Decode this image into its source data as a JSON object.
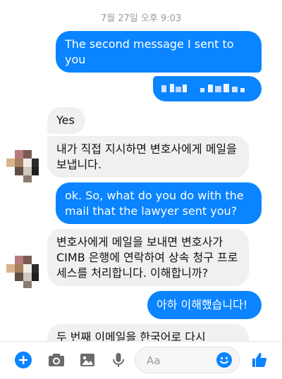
{
  "header": {
    "timestamp": "7월 27일 오후 9:03"
  },
  "messages": [
    {
      "side": "outgoing",
      "text": "The second message I sent to you"
    },
    {
      "side": "outgoing",
      "text": "",
      "note": "pixelated"
    },
    {
      "side": "incoming",
      "text": "Yes"
    },
    {
      "side": "incoming",
      "text": "내가 직접 지시하면 변호사에게 메일을 보냅니다."
    },
    {
      "side": "outgoing",
      "text": "ok. So, what do you do with the mail that the lawyer sent you?"
    },
    {
      "side": "incoming",
      "text": "변호사에게 메일을 보내면 변호사가 CIMB 은행에 연락하여 상속 청구 프로세스를 처리합니다. 이해합니까?"
    },
    {
      "side": "outgoing",
      "text": "아하 이해했습니다!"
    },
    {
      "side": "incoming",
      "text": "두 번째 이메일을 한국어로 다시"
    }
  ],
  "composer": {
    "placeholder": "Aa"
  },
  "colors": {
    "accent": "#0a84ff",
    "incoming_bg": "#f0f0f0",
    "timestamp": "#9a9a9a"
  },
  "icons": [
    "add-icon",
    "camera-icon",
    "gallery-icon",
    "microphone-icon",
    "emoji-icon",
    "like-icon"
  ]
}
